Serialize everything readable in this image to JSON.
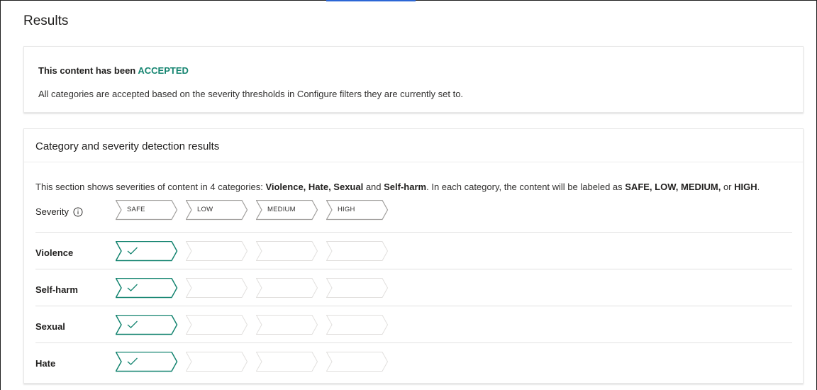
{
  "page": {
    "title": "Results"
  },
  "status": {
    "heading_prefix": "This content has been ",
    "status_word": "ACCEPTED",
    "description": "All categories are accepted based on the severity thresholds in Configure filters they are currently set to."
  },
  "results": {
    "title": "Category and severity detection results",
    "intro": {
      "t1": "This section shows severities of content in 4 categories: ",
      "c1": "Violence, Hate, Sexual",
      "t2": " and ",
      "c2": "Self-harm",
      "t3": ". In each category, the content will be labeled as ",
      "l1": "SAFE, LOW, MEDIUM,",
      "t4": " or ",
      "l2": "HIGH",
      "t5": "."
    },
    "severity_label": "Severity",
    "severity_levels": [
      "SAFE",
      "LOW",
      "MEDIUM",
      "HIGH"
    ],
    "categories": [
      {
        "name": "Violence",
        "level_index": 0
      },
      {
        "name": "Self-harm",
        "level_index": 0
      },
      {
        "name": "Sexual",
        "level_index": 0
      },
      {
        "name": "Hate",
        "level_index": 0
      }
    ]
  },
  "colors": {
    "accent": "#148470",
    "border": "#a19f9d",
    "empty_border": "#e1dfdd"
  },
  "icons": {
    "info": "info-icon",
    "check": "checkmark-icon"
  }
}
